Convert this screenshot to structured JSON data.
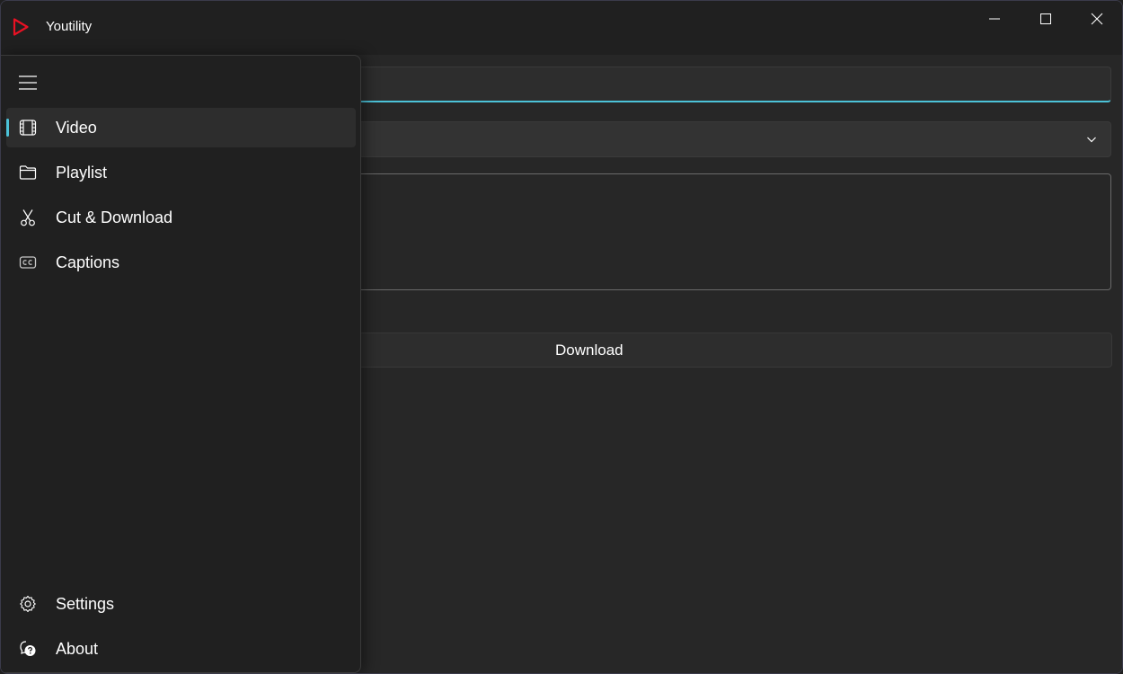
{
  "app": {
    "title": "Youtility",
    "accent_color": "#4cc2d8",
    "logo_color": "#e81123"
  },
  "title_bar": {
    "buttons": [
      "minimize-icon",
      "maximize-icon",
      "close-icon"
    ]
  },
  "main": {
    "url_input": {
      "value": "",
      "placeholder": ""
    },
    "format_select": {
      "value": ""
    },
    "download_button": {
      "label": "Download"
    }
  },
  "nav": {
    "menu_icon": "hamburger-icon",
    "items": [
      {
        "label": "Video",
        "icon": "video-frame-icon",
        "selected": true
      },
      {
        "label": "Playlist",
        "icon": "folder-icon",
        "selected": false
      },
      {
        "label": "Cut & Download",
        "icon": "scissors-icon",
        "selected": false
      },
      {
        "label": "Captions",
        "icon": "closed-captions-icon",
        "selected": false
      }
    ],
    "footer_items": [
      {
        "label": "Settings",
        "icon": "gear-icon"
      },
      {
        "label": "About",
        "icon": "about-chat-icon"
      }
    ]
  }
}
